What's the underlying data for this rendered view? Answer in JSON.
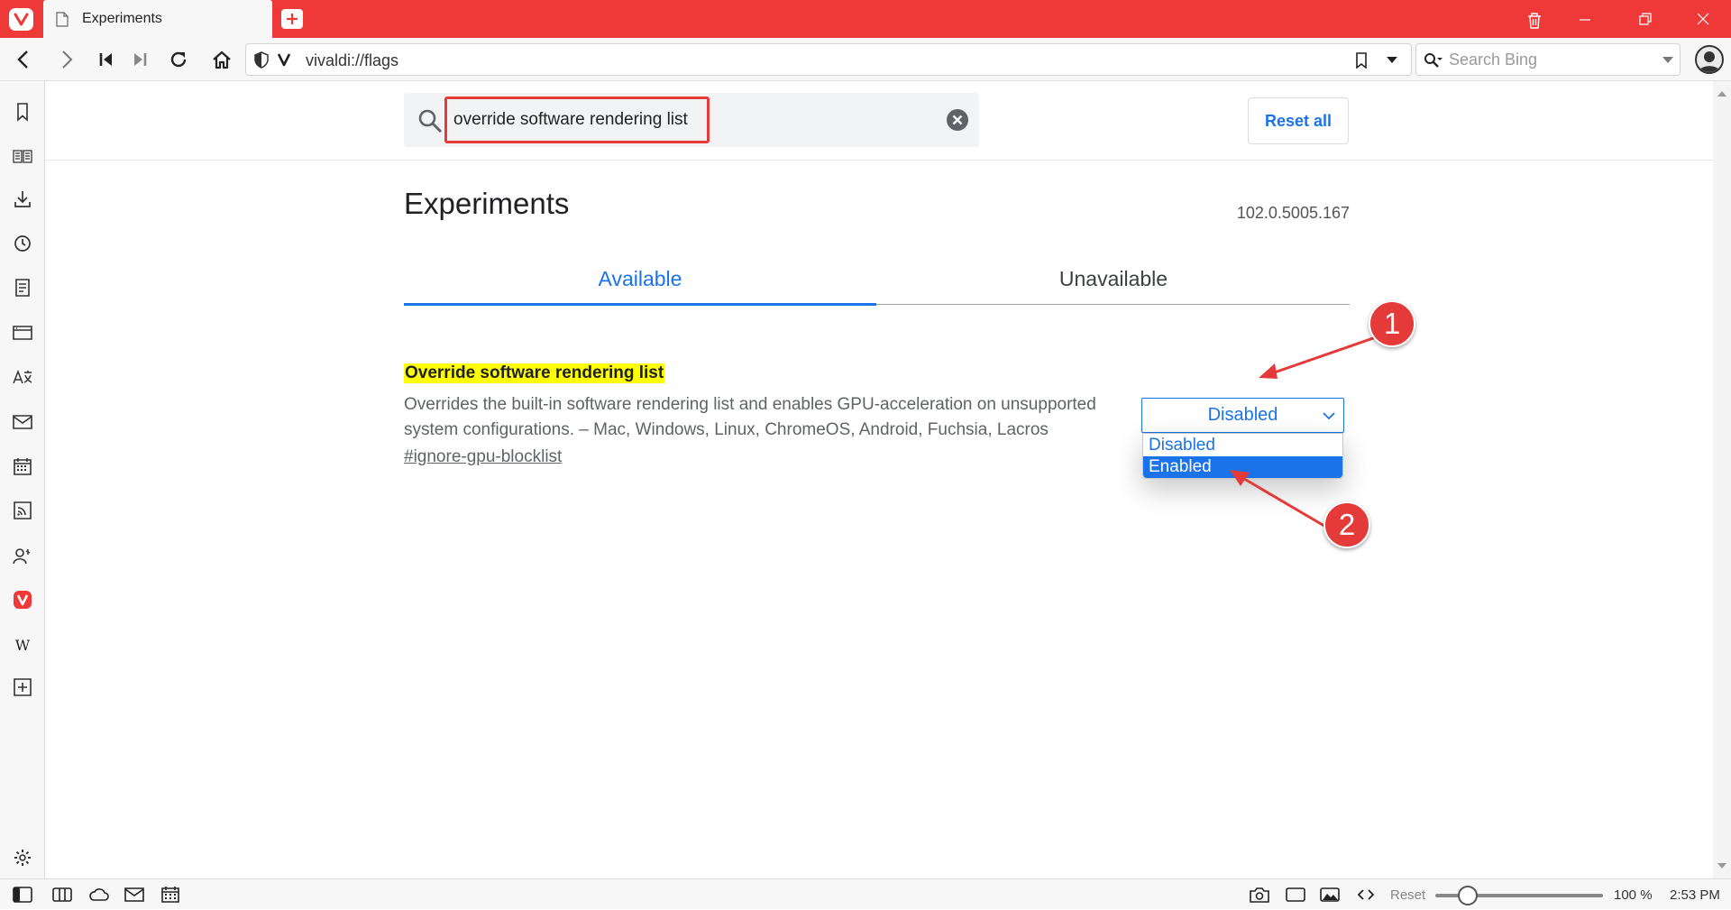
{
  "browser": {
    "tab_title": "Experiments",
    "url": "vivaldi://flags",
    "search_placeholder": "Search Bing",
    "accent_color": "#ef3939"
  },
  "side_panel": {
    "icons": [
      "bookmark-icon",
      "reading-list-icon",
      "downloads-icon",
      "history-icon",
      "notes-icon",
      "window-panel-icon",
      "translate-icon",
      "mail-icon",
      "calendar-icon",
      "feeds-icon",
      "contacts-icon",
      "vivaldi-icon",
      "wikipedia-icon",
      "add-panel-icon",
      "settings-icon"
    ]
  },
  "flags_page": {
    "search_value": "override software rendering list",
    "reset_all_label": "Reset all",
    "title": "Experiments",
    "version": "102.0.5005.167",
    "tabs": [
      {
        "label": "Available",
        "active": true
      },
      {
        "label": "Unavailable",
        "active": false
      }
    ],
    "flag": {
      "name": "Override software rendering list",
      "description": "Overrides the built-in software rendering list and enables GPU-acceleration on unsupported system configurations. – Mac, Windows, Linux, ChromeOS, Android, Fuchsia, Lacros",
      "link": "#ignore-gpu-blocklist",
      "selected_value": "Disabled",
      "options": [
        "Disabled",
        "Enabled"
      ],
      "highlighted_option": "Enabled"
    }
  },
  "annotations": {
    "badge_1": "1",
    "badge_2": "2",
    "color": "#e53a3a"
  },
  "status_bar": {
    "reset_label": "Reset",
    "zoom_level": "100 %",
    "zoom_fraction": 0.2,
    "time": "2:53 PM"
  }
}
